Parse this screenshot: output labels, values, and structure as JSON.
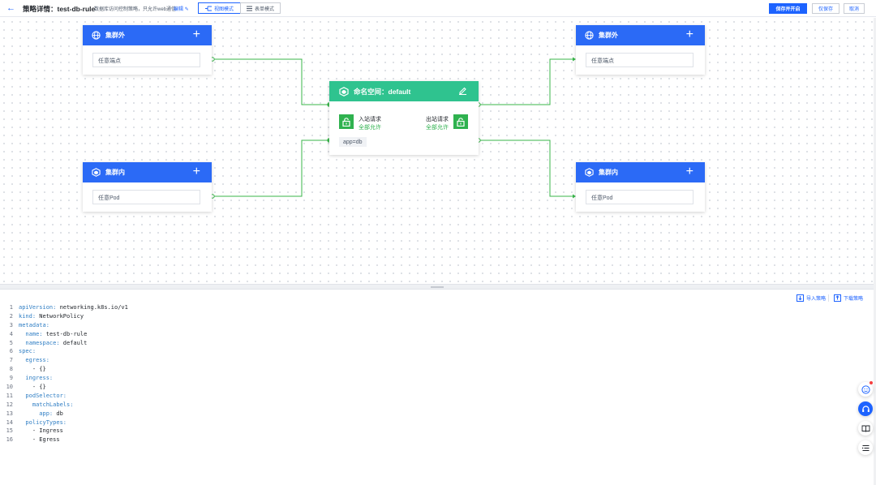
{
  "header": {
    "back_glyph": "←",
    "title": "策略详情：test-db-rule",
    "description": "数据库访问控制策略，只允许web通信",
    "edit_label": "编辑",
    "modes": [
      {
        "label": "视图模式",
        "active": true,
        "icon": "flow-icon"
      },
      {
        "label": "表单模式",
        "active": false,
        "icon": "list-icon"
      }
    ],
    "buttons": {
      "save_enable": "保存并开启",
      "save_only": "仅保存",
      "cancel": "取消"
    }
  },
  "canvas": {
    "nodes": {
      "left_outer": {
        "title": "集群外",
        "input": "任意端点"
      },
      "left_inner": {
        "title": "集群内",
        "input": "任意Pod"
      },
      "right_outer": {
        "title": "集群外",
        "input": "任意端点"
      },
      "right_inner": {
        "title": "集群内",
        "input": "任意Pod"
      }
    },
    "namespace": {
      "title": "命名空间：default",
      "ingress_label": "入站请求",
      "ingress_value": "全部允许",
      "egress_label": "出站请求",
      "egress_value": "全部允许",
      "tag": "app=db"
    },
    "colors": {
      "outer_header": "#2b6af6",
      "namespace_header": "#2fc38f",
      "connector": "#39b54a",
      "allow": "#2fb24f"
    }
  },
  "editor": {
    "tools": {
      "import": "导入策略",
      "download": "下载策略"
    },
    "lines": [
      {
        "n": "1",
        "key": "apiVersion:",
        "val": " networking.k8s.io/v1"
      },
      {
        "n": "2",
        "key": "kind:",
        "val": " NetworkPolicy"
      },
      {
        "n": "3",
        "key": "metadata:",
        "val": ""
      },
      {
        "n": "4",
        "key": "  name:",
        "val": " test-db-rule"
      },
      {
        "n": "5",
        "key": "  namespace:",
        "val": " default"
      },
      {
        "n": "6",
        "key": "spec:",
        "val": ""
      },
      {
        "n": "7",
        "key": "  egress:",
        "val": ""
      },
      {
        "n": "8",
        "key": "",
        "val": "    - {}"
      },
      {
        "n": "9",
        "key": "  ingress:",
        "val": ""
      },
      {
        "n": "10",
        "key": "",
        "val": "    - {}"
      },
      {
        "n": "11",
        "key": "  podSelector:",
        "val": ""
      },
      {
        "n": "12",
        "key": "    matchLabels:",
        "val": ""
      },
      {
        "n": "13",
        "key": "      app:",
        "val": " db"
      },
      {
        "n": "14",
        "key": "  policyTypes:",
        "val": ""
      },
      {
        "n": "15",
        "key": "",
        "val": "    - Ingress"
      },
      {
        "n": "16",
        "key": "",
        "val": "    - Egress"
      }
    ]
  },
  "fabs": [
    "smile-icon",
    "headset-icon",
    "book-icon",
    "list-icon"
  ]
}
